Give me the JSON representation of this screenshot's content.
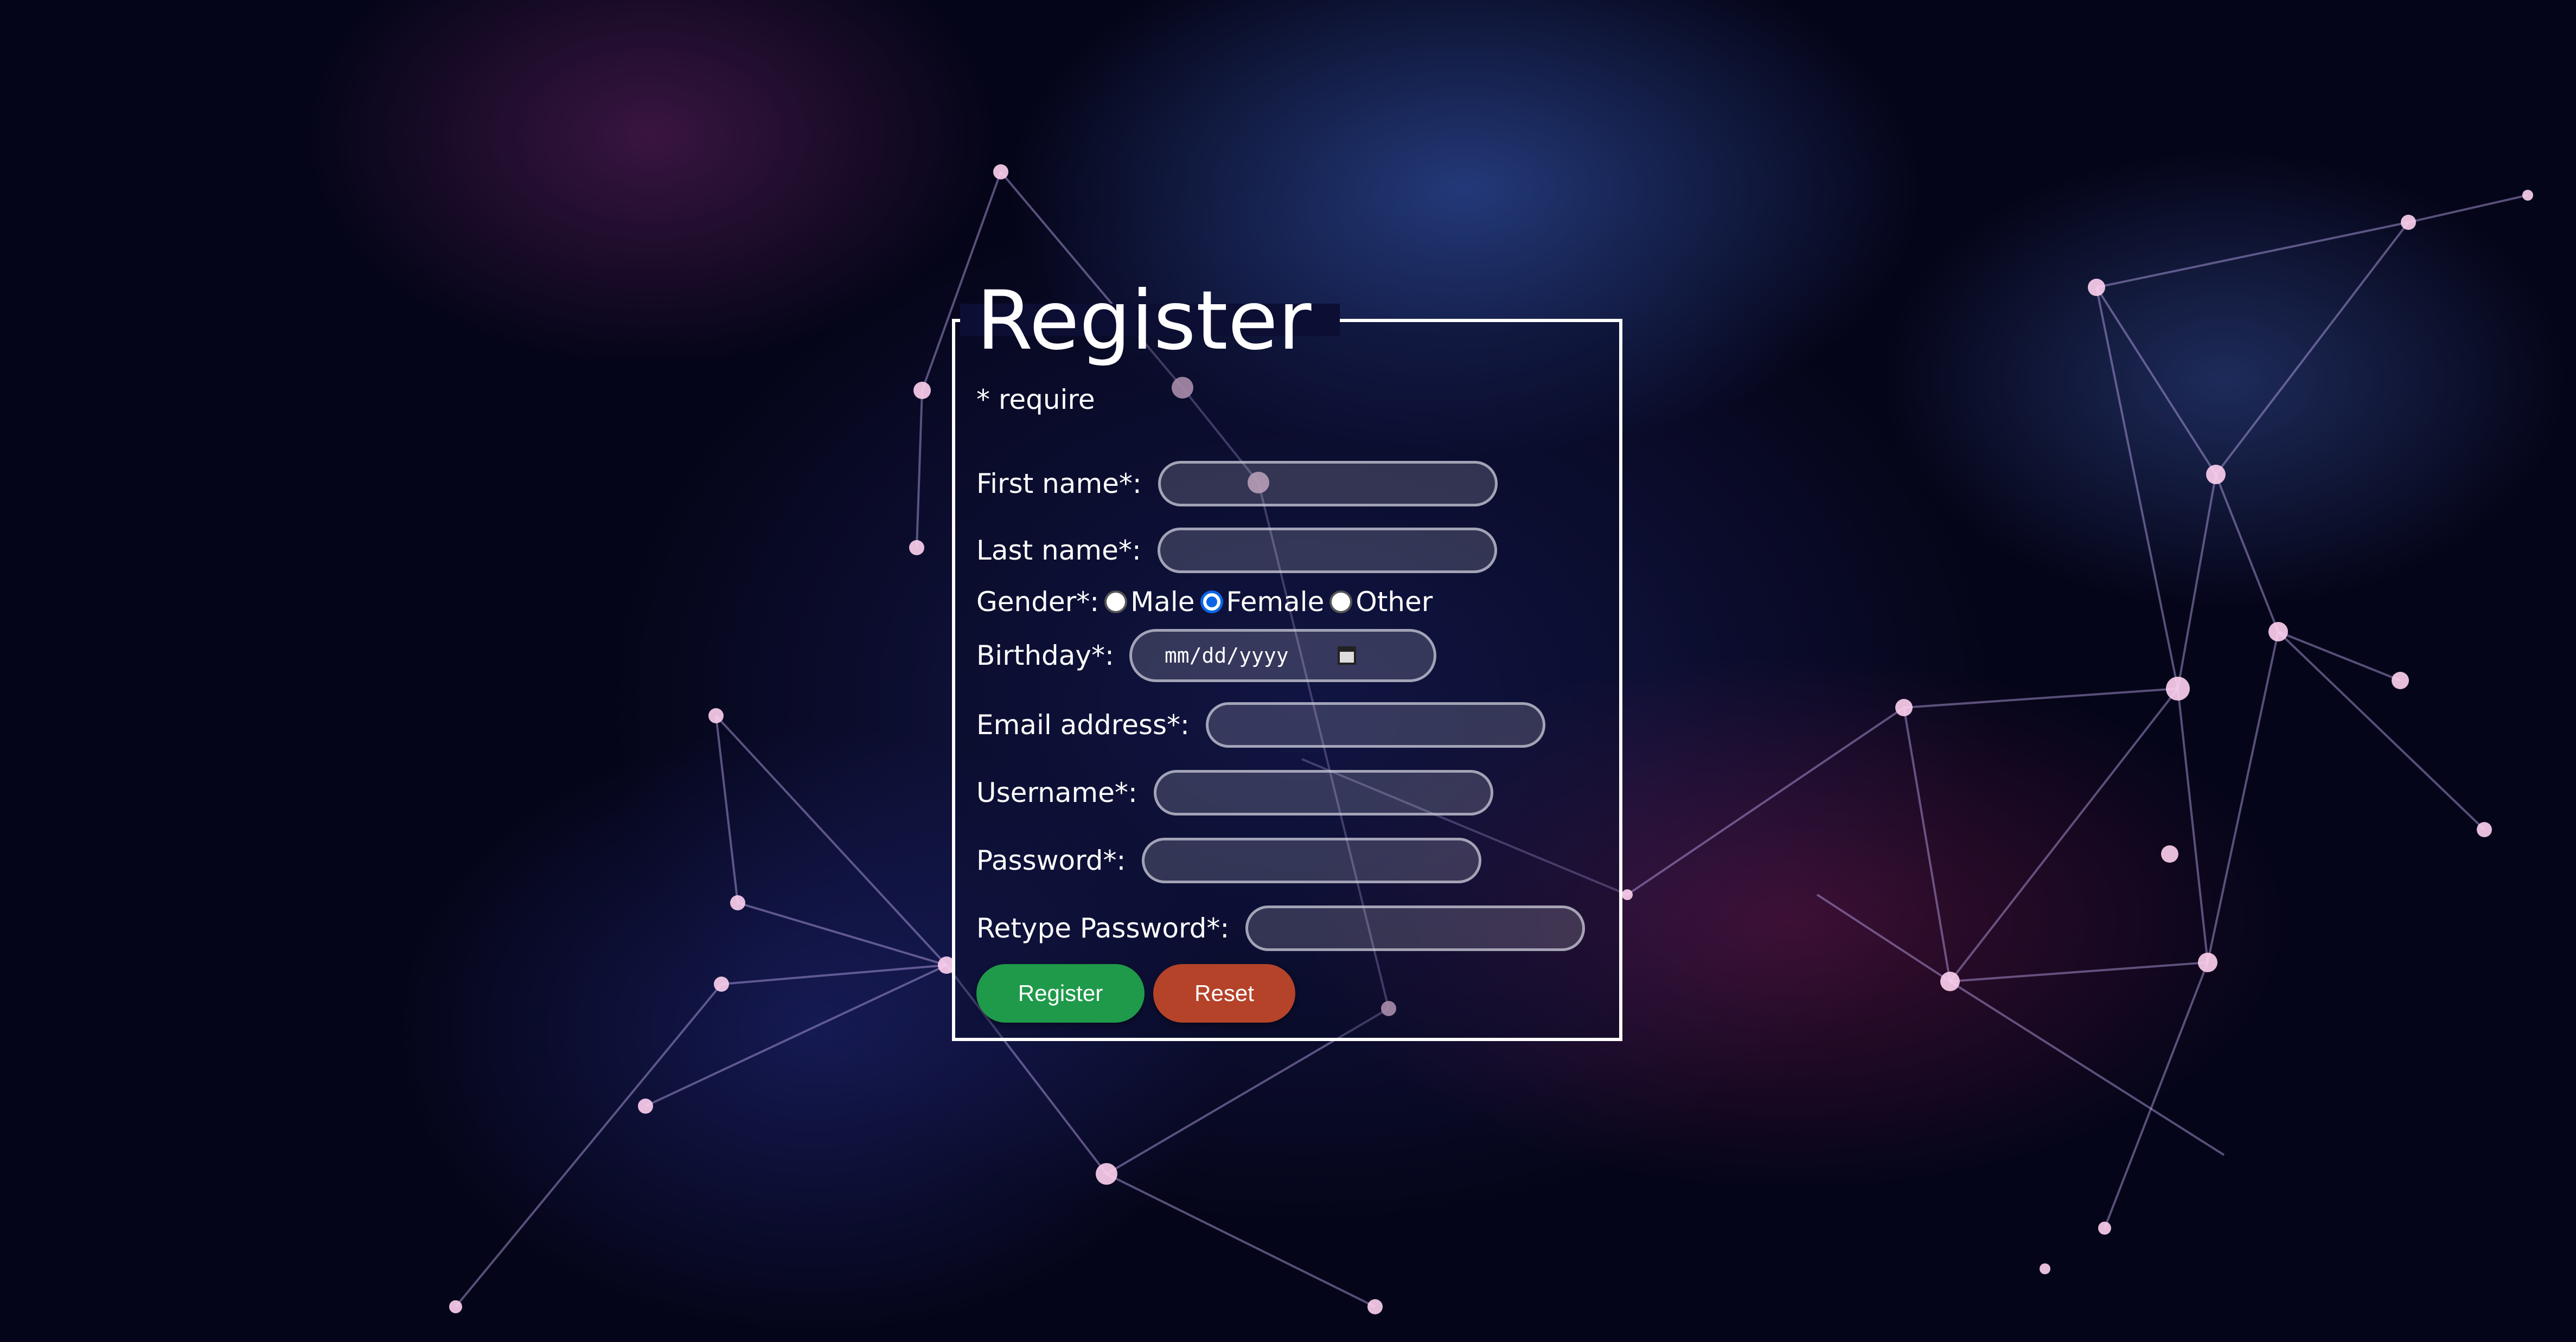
{
  "form": {
    "title": "Register",
    "require_note": "* require",
    "first_name_label": "First name*:",
    "last_name_label": "Last name*:",
    "gender_label": "Gender*:",
    "gender_options": [
      "Male",
      "Female",
      "Other"
    ],
    "gender_selected": "Female",
    "birthday_label": "Birthday*:",
    "birthday_placeholder": "mm/dd/yyyy",
    "email_label": "Email address*:",
    "username_label": "Username*:",
    "password_label": "Password*:",
    "retype_password_label": "Retype Password*:",
    "register_button": "Register",
    "reset_button": "Reset"
  },
  "colors": {
    "register_button": "#1f9a4a",
    "reset_button": "#b4432a",
    "radio_selected": "#0a66e6",
    "frame_border": "#ffffff"
  }
}
